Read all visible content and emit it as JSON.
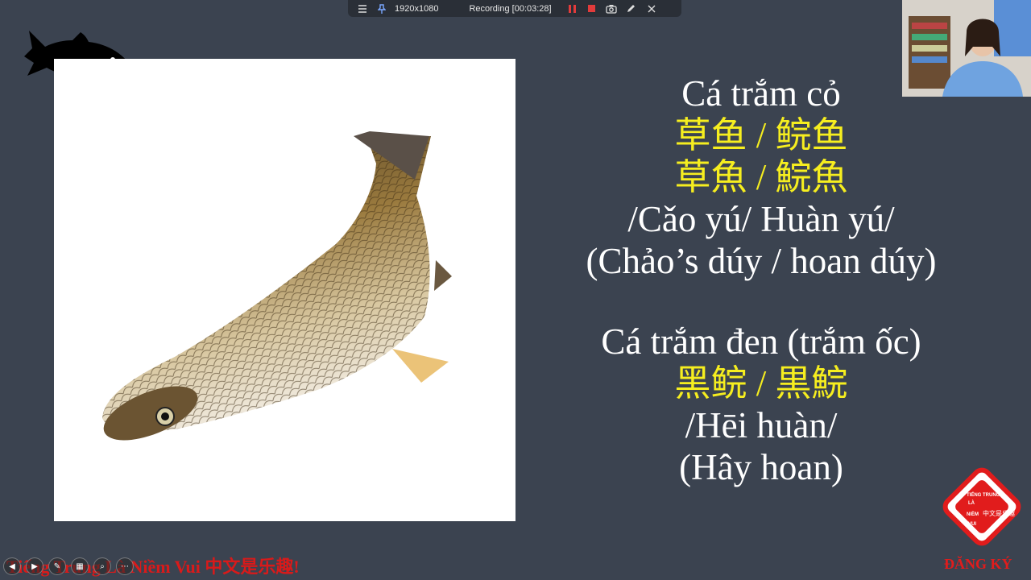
{
  "recording_bar": {
    "resolution": "1920x1080",
    "status": "Recording [00:03:28]",
    "icons": [
      "menu-icon",
      "pin-icon",
      "pause-icon",
      "stop-icon",
      "camera-icon",
      "pen-icon",
      "close-icon"
    ]
  },
  "slide": {
    "block1": {
      "vietnamese": "Cá trắm cỏ",
      "simplified": "草鱼 / 鲩鱼",
      "traditional": "草魚 / 鯇魚",
      "pinyin": "/Cǎo yú/ Huàn yú/",
      "reading": "(Chảo’s dúy / hoan dúy)"
    },
    "block2": {
      "vietnamese": "Cá trắm đen (trắm ốc)",
      "chinese": "黑鲩 / 黒鯇",
      "pinyin": "/Hēi huàn/",
      "reading": "(Hây hoan)"
    }
  },
  "branding": {
    "logo_left": "TIẾNG TRUNG",
    "logo_left2": "LÀ",
    "logo_left3": "NIỀM",
    "logo_left4": "VUI",
    "logo_right": "中文是乐趣",
    "subscribe": "ĐĂNG KÝ"
  },
  "ticker": "Tiếng Trung Là Niềm Vui 中文是乐趣!",
  "colors": {
    "background": "#3b4350",
    "highlight": "#f6ee1f",
    "brand_red": "#e11c1c"
  }
}
